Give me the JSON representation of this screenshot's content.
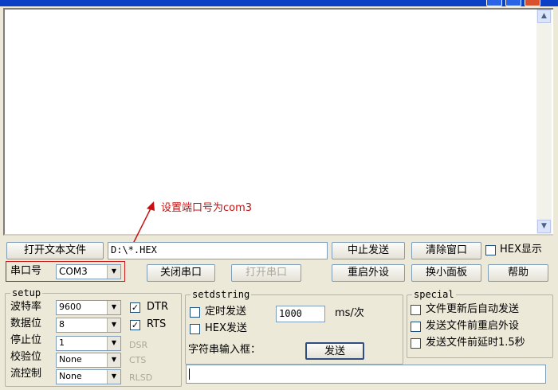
{
  "toolbar": {
    "open_file": "打开文本文件",
    "file_path": "D:\\*.HEX",
    "stop_send": "中止发送",
    "clear_window": "清除窗口",
    "hex_display": "HEX显示"
  },
  "port": {
    "label": "串口号",
    "value": "COM3",
    "close_port": "关闭串口",
    "open_port": "打开串口",
    "restart_device": "重启外设",
    "small_panel": "换小面板",
    "help": "帮助"
  },
  "annotation": {
    "text": "设置端口号为com3",
    "color": "#c81010"
  },
  "setup": {
    "legend": "setup",
    "baud_label": "波特率",
    "baud_value": "9600",
    "data_bits_label": "数据位",
    "data_bits_value": "8",
    "stop_bits_label": "停止位",
    "stop_bits_value": "1",
    "parity_label": "校验位",
    "parity_value": "None",
    "flow_label": "流控制",
    "flow_value": "None",
    "dtr": "DTR",
    "rts": "RTS",
    "dsr": "DSR",
    "cts": "CTS",
    "rlsd": "RLSD"
  },
  "setdstring": {
    "legend": "setdstring",
    "timed_send": "定时发送",
    "interval_value": "1000",
    "interval_unit": "ms/次",
    "hex_send": "HEX发送",
    "input_label": "字符串输入框：",
    "send": "发送"
  },
  "special": {
    "legend": "special",
    "auto_send_on_update": "文件更新后自动发送",
    "restart_before_send": "发送文件前重启外设",
    "delay_before_send": "发送文件前延时1.5秒"
  },
  "checks": {
    "mark": "✓"
  }
}
